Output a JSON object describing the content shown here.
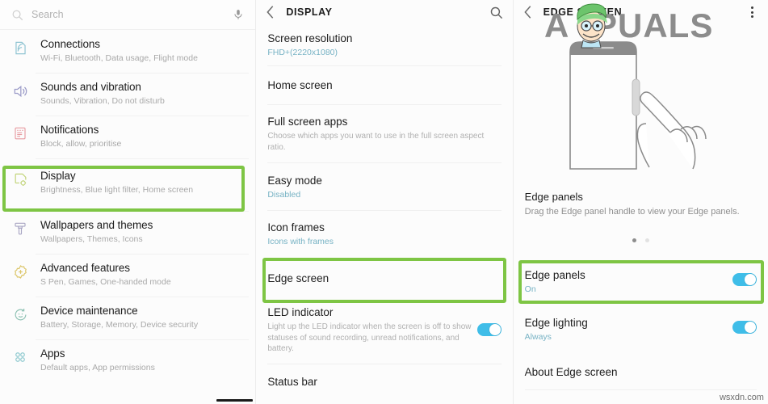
{
  "panel1": {
    "search": {
      "placeholder": "Search",
      "icon": "search-icon",
      "mic_icon": "microphone-icon"
    },
    "items": [
      {
        "title": "Connections",
        "subtitle": "Wi-Fi, Bluetooth, Data usage, Flight mode",
        "icon": "connections-icon"
      },
      {
        "title": "Sounds and vibration",
        "subtitle": "Sounds, Vibration, Do not disturb",
        "icon": "sound-icon"
      },
      {
        "title": "Notifications",
        "subtitle": "Block, allow, prioritise",
        "icon": "notifications-icon"
      },
      {
        "title": "Display",
        "subtitle": "Brightness, Blue light filter, Home screen",
        "icon": "display-icon",
        "highlighted": true
      },
      {
        "title": "Wallpapers and themes",
        "subtitle": "Wallpapers, Themes, Icons",
        "icon": "wallpaper-brush-icon"
      },
      {
        "title": "Advanced features",
        "subtitle": "S Pen, Games, One-handed mode",
        "icon": "advanced-features-icon"
      },
      {
        "title": "Device maintenance",
        "subtitle": "Battery, Storage, Memory, Device security",
        "icon": "device-maintenance-icon"
      },
      {
        "title": "Apps",
        "subtitle": "Default apps, App permissions",
        "icon": "apps-icon"
      }
    ]
  },
  "panel2": {
    "appbar": {
      "title": "DISPLAY",
      "back_icon": "back-chevron-icon",
      "action_icon": "search-icon"
    },
    "items": [
      {
        "title": "Screen resolution",
        "value": "FHD+(2220x1080)"
      },
      {
        "title": "Home screen"
      },
      {
        "title": "Full screen apps",
        "description": "Choose which apps you want to use in the full screen aspect ratio."
      },
      {
        "title": "Easy mode",
        "value": "Disabled"
      },
      {
        "title": "Icon frames",
        "value": "Icons with frames"
      },
      {
        "title": "Edge screen",
        "highlighted": true
      },
      {
        "title": "LED indicator",
        "description": "Light up the LED indicator when the screen is off to show statuses of sound recording, unread notifications, and battery.",
        "toggle": "on"
      },
      {
        "title": "Status bar"
      }
    ]
  },
  "panel3": {
    "appbar": {
      "title": "EDGE SCREEN",
      "back_icon": "back-chevron-icon",
      "action_icon": "more-options-icon"
    },
    "hero": {
      "illustration": "phone-edge-panel-handle-illustration",
      "dots": [
        "active",
        "inactive"
      ]
    },
    "hero_title": "Edge panels",
    "hero_description": "Drag the Edge panel handle to view your Edge panels.",
    "items": [
      {
        "title": "Edge panels",
        "value": "On",
        "toggle": "on",
        "highlighted": true
      },
      {
        "title": "Edge lighting",
        "value": "Always",
        "toggle": "on"
      },
      {
        "title": "About Edge screen"
      }
    ],
    "watermark": "APPUALS",
    "site_watermark": "wsxdn.com"
  },
  "colors": {
    "highlight_green": "#7ec544",
    "toggle_blue": "#3fbde8",
    "accent_teal": "#76b2c4"
  }
}
